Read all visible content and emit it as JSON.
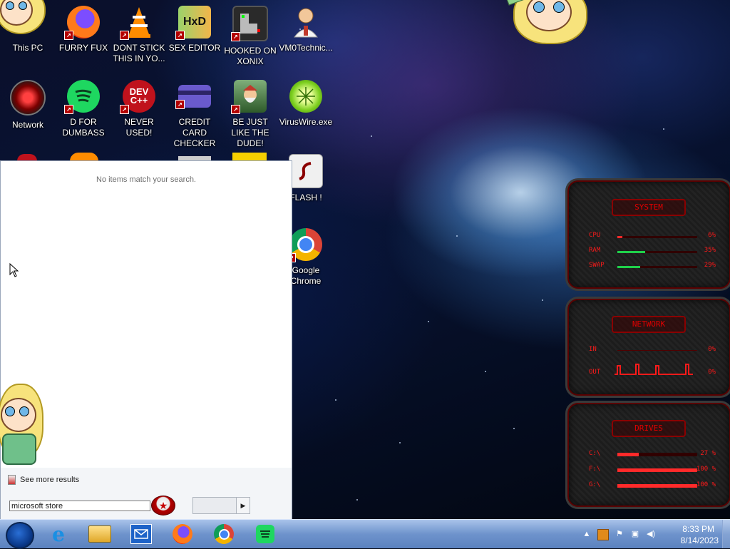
{
  "desktop": {
    "icons": [
      {
        "label": "This PC",
        "icon": "this-pc-icon"
      },
      {
        "label": "FURRY FUX",
        "icon": "firefox-icon"
      },
      {
        "label": "DONT STICK THIS IN YO...",
        "icon": "vlc-icon"
      },
      {
        "label": "SEX EDITOR",
        "icon": "hxd-icon"
      },
      {
        "label": "HOOKED ON XONIX",
        "icon": "xonix-icon"
      },
      {
        "label": "VM0Technic...",
        "icon": "doctor-icon"
      },
      {
        "label": "Network",
        "icon": "network-icon"
      },
      {
        "label": "D FOR DUMBASS",
        "icon": "spotify-icon"
      },
      {
        "label": "NEVER USED!",
        "icon": "dev-cpp-icon"
      },
      {
        "label": "CREDIT CARD CHECKER",
        "icon": "credit-card-icon"
      },
      {
        "label": "BE JUST LIKE THE DUDE!",
        "icon": "dude-icon"
      },
      {
        "label": "VirusWire.exe",
        "icon": "limewire-icon"
      },
      {
        "label": "FLASH !",
        "icon": "flash-icon"
      },
      {
        "label": "Google Chrome",
        "icon": "chrome-icon"
      }
    ],
    "icon_texts": {
      "dev": "DEV",
      "dev_plus": "C++",
      "hxd": "HxD"
    }
  },
  "start_menu": {
    "no_results_text": "No items match your search.",
    "see_more_label": "See more results",
    "search_value": "microsoft store",
    "shutdown_label": ""
  },
  "gadget": {
    "system": {
      "title": "SYSTEM",
      "rows": [
        {
          "label": "CPU",
          "value": "6%",
          "fill": 0.06
        },
        {
          "label": "RAM",
          "value": "35%",
          "fill": 0.35
        },
        {
          "label": "SWAP",
          "value": "29%",
          "fill": 0.29
        }
      ]
    },
    "network": {
      "title": "NETWORK",
      "rows": [
        {
          "label": "IN",
          "value": "0%"
        },
        {
          "label": "OUT",
          "value": "0%"
        }
      ]
    },
    "drives": {
      "title": "DRIVES",
      "rows": [
        {
          "label": "C:\\",
          "value": "27 %",
          "fill": 0.27
        },
        {
          "label": "F:\\",
          "value": "100 %",
          "fill": 1.0
        },
        {
          "label": "G:\\",
          "value": "100 %",
          "fill": 1.0
        }
      ]
    },
    "accent_color": "#ff1a1a"
  },
  "taskbar": {
    "pinned": [
      "internet-explorer-icon",
      "file-explorer-icon",
      "mail-icon",
      "firefox-icon",
      "chrome-icon",
      "spotify-icon"
    ],
    "tray_icons": [
      "show-hidden-icons-icon",
      "app-tray-icon",
      "action-center-flag-icon",
      "network-tray-icon",
      "volume-icon"
    ],
    "clock_time": "8:33 PM",
    "clock_date": "8/14/2023"
  }
}
